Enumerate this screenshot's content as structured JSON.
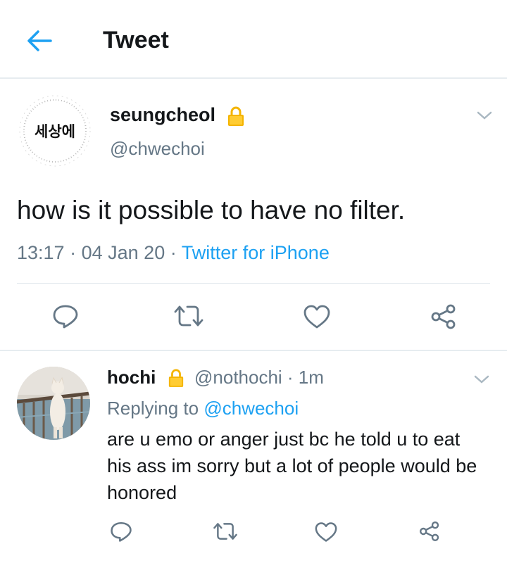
{
  "header": {
    "title": "Tweet"
  },
  "tweet": {
    "avatar_text": "세상에",
    "display_name": "seungcheol",
    "handle": "@chwechoi",
    "text": "how is it possible to have no filter.",
    "time": "13:17",
    "date": "04 Jan 20",
    "separator": "·",
    "source": "Twitter for iPhone"
  },
  "reply": {
    "display_name": "hochi",
    "handle_time": "@nothochi · 1m",
    "replying_prefix": "Replying to",
    "replying_to": "@chwechoi",
    "text": "are u emo or anger just bc he told u to eat his ass im sorry but a lot of people would be honored"
  },
  "icons": [
    "back-arrow-icon",
    "lock-icon",
    "chevron-down-icon",
    "reply-icon",
    "retweet-icon",
    "like-icon",
    "share-icon"
  ],
  "colors": {
    "accent": "#1da1f2",
    "secondary_text": "#657786",
    "lock": "#f4b400"
  }
}
